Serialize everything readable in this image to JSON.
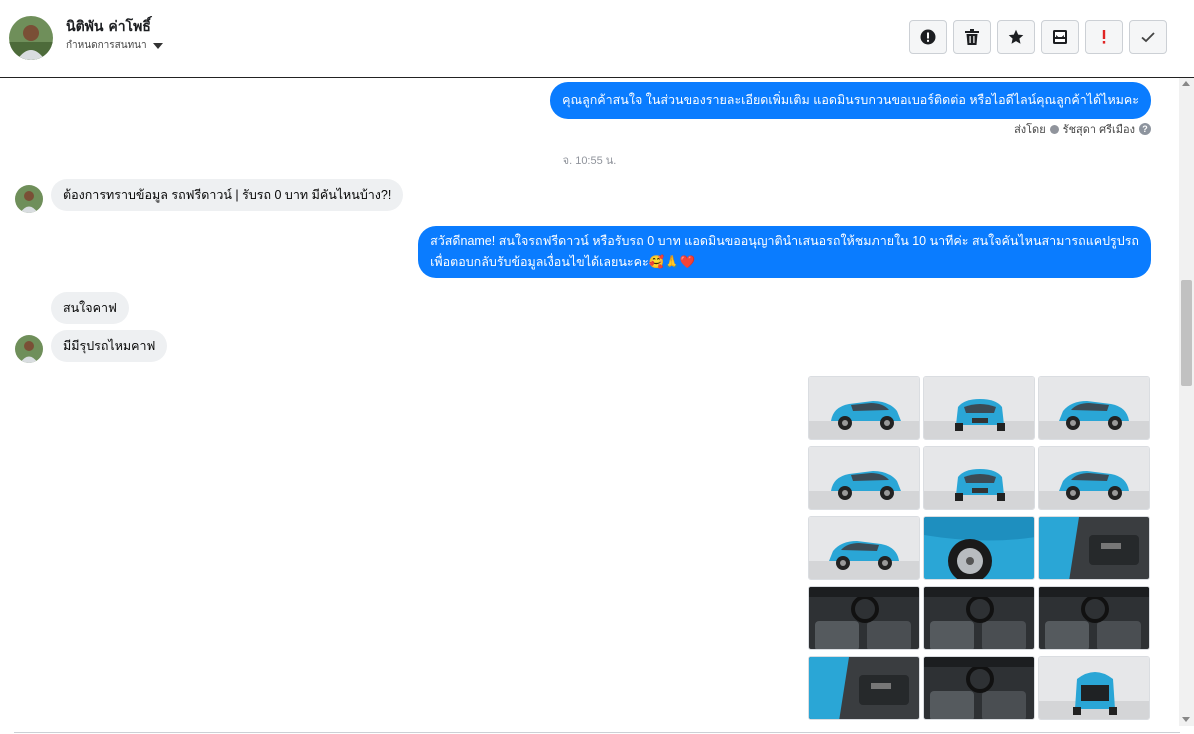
{
  "header": {
    "contact_name": "นิติพัน ค่าโพธิ์",
    "sub_action": "กำหนดการสนทนา",
    "toolbar": [
      {
        "name": "report-spam-button",
        "icon": "exclamation-circle-icon"
      },
      {
        "name": "delete-button",
        "icon": "trash-icon"
      },
      {
        "name": "star-button",
        "icon": "star-icon"
      },
      {
        "name": "archive-button",
        "icon": "archive-icon"
      },
      {
        "name": "mark-important-button",
        "icon": "exclamation-icon"
      },
      {
        "name": "mark-done-button",
        "icon": "check-icon"
      }
    ]
  },
  "thread": {
    "msg1": "คุณลูกค้าสนใจ ในส่วนของรายละเอียดเพิ่มเติม แอดมินรบกวนขอเบอร์ติดต่อ หรือไอดีไลน์คุณลูกค้าได้ไหมคะ",
    "sent_by_label": "ส่งโดย",
    "sent_by_name": "รัชสุดา ศรีเมือง",
    "timestamp": "จ. 10:55 น.",
    "msg2": "ต้องการทราบข้อมูล รถฟรีดาวน์ | รับรถ 0 บาท มีคันไหนบ้าง?!",
    "msg3_line1": "สวัสดีname! สนใจรถฟรีดาวน์ หรือรับรถ 0 บาท แอดมินขออนุญาตินำเสนอรถให้ชมภายใน 10 นาทีค่ะ สนใจคันไหนสามารถแคปรูปรถ",
    "msg3_line2": "เพื่อตอบกลับรับข้อมูลเงื่อนไขได้เลยนะคะ🥰🙏❤️",
    "msg4": "สนใจคาฟ",
    "msg5": "มีมีรุปรถไหมคาฟ"
  },
  "colors": {
    "outgoing_bubble": "#0a7cff",
    "incoming_bubble": "#eef0f2",
    "car_body": "#2aa6d6"
  },
  "gallery": [
    {
      "view": "front-left"
    },
    {
      "view": "front"
    },
    {
      "view": "front-right"
    },
    {
      "view": "rear-left"
    },
    {
      "view": "rear"
    },
    {
      "view": "rear-right"
    },
    {
      "view": "side"
    },
    {
      "view": "wheel"
    },
    {
      "view": "door-interior"
    },
    {
      "view": "dashboard"
    },
    {
      "view": "gear-shift"
    },
    {
      "view": "steering-wheel"
    },
    {
      "view": "rear-seats"
    },
    {
      "view": "cabin"
    },
    {
      "view": "trunk"
    }
  ]
}
